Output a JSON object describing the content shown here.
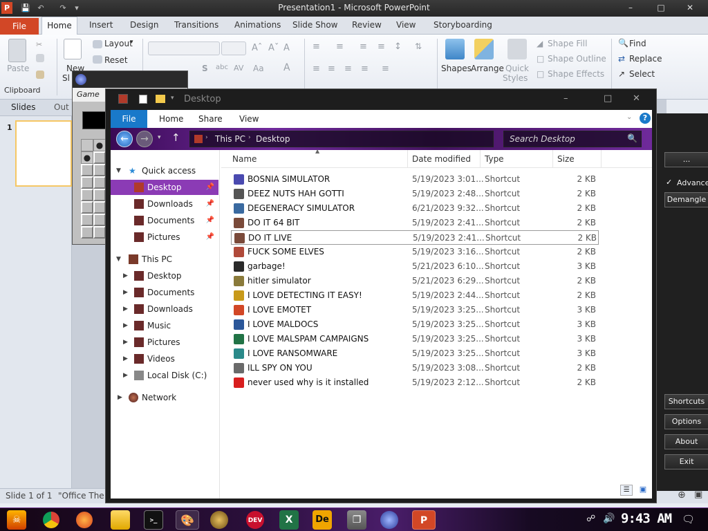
{
  "powerpoint": {
    "title": "Presentation1 - Microsoft PowerPoint",
    "logo": "P",
    "tabs": {
      "file": "File",
      "home": "Home",
      "insert": "Insert",
      "design": "Design",
      "transitions": "Transitions",
      "animations": "Animations",
      "slideshow": "Slide Show",
      "review": "Review",
      "view": "View",
      "storyboarding": "Storyboarding"
    },
    "ribbon": {
      "paste": "Paste",
      "clipboard": "Clipboard",
      "new_slide": "New",
      "new_slide_2": "Sl",
      "layout": "Layout",
      "reset": "Reset",
      "shapes": "Shapes",
      "arrange": "Arrange",
      "quick_styles": "Quick",
      "quick_styles_2": "Styles",
      "shape_fill": "Shape Fill",
      "shape_outline": "Shape Outline",
      "shape_effects": "Shape Effects",
      "find": "Find",
      "replace": "Replace",
      "select": "Select"
    },
    "left_tabs": {
      "slides": "Slides",
      "outline": "Out"
    },
    "slide_number": "1",
    "status": {
      "slide": "Slide 1 of 1",
      "theme": "\"Office The"
    }
  },
  "minesweeper": {
    "menu": "Game"
  },
  "side_app": {
    "buttons": {
      "more": "...",
      "advanced": "Advanced",
      "demangle": "Demangle",
      "shortcuts": "Shortcuts",
      "options": "Options",
      "about": "About",
      "exit": "Exit"
    }
  },
  "explorer": {
    "title": "Desktop",
    "ribbon_tabs": {
      "file": "File",
      "home": "Home",
      "share": "Share",
      "view": "View"
    },
    "address": {
      "root": "This PC",
      "current": "Desktop"
    },
    "search_placeholder": "Search Desktop",
    "nav": {
      "quick_access": "Quick access",
      "qa_items": [
        "Desktop",
        "Downloads",
        "Documents",
        "Pictures"
      ],
      "this_pc": "This PC",
      "pc_items": [
        "Desktop",
        "Documents",
        "Downloads",
        "Music",
        "Pictures",
        "Videos",
        "Local Disk (C:)"
      ],
      "network": "Network"
    },
    "columns": {
      "name": "Name",
      "date": "Date modified",
      "type": "Type",
      "size": "Size"
    },
    "files": [
      {
        "name": "BOSNIA SIMULATOR",
        "date": "5/19/2023 3:01...",
        "type": "Shortcut",
        "size": "2 KB",
        "icon_color": "#4a4ab0"
      },
      {
        "name": "DEEZ NUTS HAH GOTTI",
        "date": "5/19/2023 2:48...",
        "type": "Shortcut",
        "size": "2 KB",
        "icon_color": "#555555"
      },
      {
        "name": "DEGENERACY SIMULATOR",
        "date": "6/21/2023 9:32...",
        "type": "Shortcut",
        "size": "2 KB",
        "icon_color": "#3a6aa0"
      },
      {
        "name": "DO IT 64 BIT",
        "date": "5/19/2023 2:41...",
        "type": "Shortcut",
        "size": "2 KB",
        "icon_color": "#7a4a3a"
      },
      {
        "name": "DO IT LIVE",
        "date": "5/19/2023 2:41...",
        "type": "Shortcut",
        "size": "2 KB",
        "icon_color": "#7a4a3a"
      },
      {
        "name": "FUCK SOME ELVES",
        "date": "5/19/2023 3:16...",
        "type": "Shortcut",
        "size": "2 KB",
        "icon_color": "#b04a3a"
      },
      {
        "name": "garbage!",
        "date": "5/21/2023 6:10...",
        "type": "Shortcut",
        "size": "3 KB",
        "icon_color": "#2a2a2a"
      },
      {
        "name": "hitler simulator",
        "date": "5/21/2023 6:29...",
        "type": "Shortcut",
        "size": "2 KB",
        "icon_color": "#8a7a3a"
      },
      {
        "name": "I LOVE DETECTING IT EASY!",
        "date": "5/19/2023 2:44...",
        "type": "Shortcut",
        "size": "2 KB",
        "icon_color": "#c89a1a"
      },
      {
        "name": "I LOVE EMOTET",
        "date": "5/19/2023 3:25...",
        "type": "Shortcut",
        "size": "3 KB",
        "icon_color": "#d24726"
      },
      {
        "name": "I LOVE MALDOCS",
        "date": "5/19/2023 3:25...",
        "type": "Shortcut",
        "size": "3 KB",
        "icon_color": "#2b579a"
      },
      {
        "name": "I LOVE MALSPAM CAMPAIGNS",
        "date": "5/19/2023 3:25...",
        "type": "Shortcut",
        "size": "3 KB",
        "icon_color": "#217346"
      },
      {
        "name": "I LOVE RANSOMWARE",
        "date": "5/19/2023 3:25...",
        "type": "Shortcut",
        "size": "3 KB",
        "icon_color": "#2a8a8a"
      },
      {
        "name": "ILL SPY ON YOU",
        "date": "5/19/2023 3:08...",
        "type": "Shortcut",
        "size": "2 KB",
        "icon_color": "#6a6a6a"
      },
      {
        "name": "never used why is it installed",
        "date": "5/19/2023 2:12...",
        "type": "Shortcut",
        "size": "2 KB",
        "icon_color": "#d81e1e"
      }
    ]
  },
  "taskbar": {
    "clock": "9:43 AM",
    "dev_label": "DEV",
    "de_label": "De"
  }
}
